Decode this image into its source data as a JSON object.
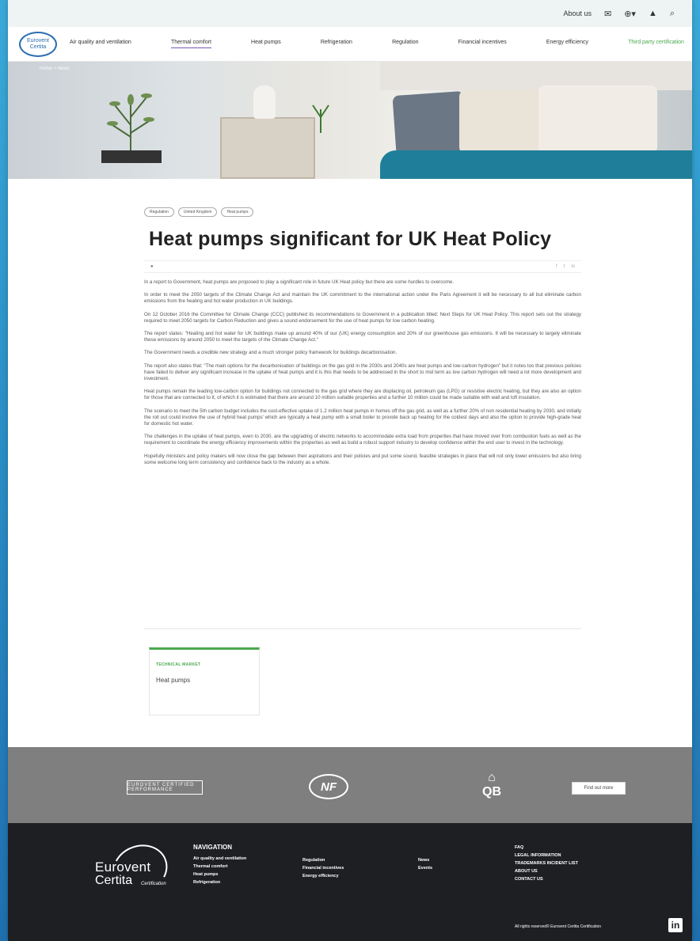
{
  "utility_bar": {
    "about_label": "About us",
    "mail_icon": "mail-icon",
    "globe_icon": "globe-icon",
    "user_icon": "user-icon",
    "search_icon": "search-icon"
  },
  "nav": {
    "logo_text_1": "Eurovent",
    "logo_text_2": "Certita",
    "items": [
      {
        "label": "Air quality and ventilation"
      },
      {
        "label": "Thermal comfort"
      },
      {
        "label": "Heat pumps"
      },
      {
        "label": "Refrigeration"
      },
      {
        "label": "Regulation"
      },
      {
        "label": "Financial incentives"
      },
      {
        "label": "Energy efficiency"
      },
      {
        "label": "Third party certification"
      }
    ]
  },
  "hero": {
    "breadcrumb": "Home > News"
  },
  "article": {
    "tags": [
      "Regulation",
      "United Kingdom",
      "Heat pumps"
    ],
    "title": "Heat pumps significant for UK Heat Policy",
    "date": "",
    "paragraphs": [
      "In a report to Government, heat pumps are proposed to play a significant role in future UK Heat policy but there are some hurdles to overcome.",
      "In order to meet the 2050 targets of the Climate Change Act and maintain the UK commitment to the international action under the Paris Agreement it will be necessary to all but eliminate carbon emissions from the heating and hot water production in UK buildings.",
      "On 12 October 2016 the Committee for Climate Change (CCC) published its recommendations to Government in a publication titled: Next Steps for UK Heat Policy. This report sets out the strategy required to meet 2050 targets for Carbon Reduction and gives a sound endorsement for the use of heat pumps for low carbon heating.",
      "The report states: \"Heating and hot water for UK buildings make up around 40% of our (UK) energy consumption and 20% of our greenhouse gas emissions. It will be necessary to largely eliminate these emissions by around 2050 to meet the targets of the Climate Change Act.\"",
      "The Government needs a credible new strategy and a much stronger policy framework for buildings decarbonisation.",
      "The report also states that: \"The main options for the decarbonisation of buildings on the gas grid in the 2030s and 2040s are heat pumps and low-carbon hydrogen\" but it notes too that previous policies have failed to deliver any significant increase in the uptake of heat pumps and it is this that needs to be addressed in the short to mid term as low carbon hydrogen will need a lot more development and investment.",
      "Heat pumps remain the leading low-carbon option for buildings not connected to the gas grid where they are displacing oil, petroleum gas (LPG) or resistive electric heating, but they are also an option for those that are connected to it, of which it is estimated that there are around 10 million suitable properties and a further 10 million could be made suitable with wall and loft insulation.",
      "The scenario to meet the 5th carbon budget includes the cost-effective uptake of 1.2 million heat pumps in homes off the gas grid, as well as a further 20% of non residential heating by 2030, and initially the roll out could involve the use of hybrid heat pumps' which are typically a heat pump with a small boiler to provide back up heating for the coldest days and also the option to provide high-grade heat for domestic hot water.",
      "The challenges in the uptake of heat pumps, even to 2030, are the upgrading of electric networks to accommodate extra load from properties that have moved over from combustion fuels as well as the requirement to coordinate the energy efficiency improvements within the properties as well as build a robust support industry to develop confidence within the end user to invest in the technology.",
      "Hopefully ministers and policy makers will now close the gap between their aspirations and their policies and put some sound, feasible strategies in place that will not only lower emissions but also bring some welcome long term consistency and confidence back to the industry as a whole."
    ]
  },
  "related": {
    "heading": "TECHNICAL MARKET",
    "value": "Heat pumps"
  },
  "logos": {
    "eurovent_label": "EUROVENT CERTIFIED PERFORMANCE",
    "nf_label": "NF",
    "qb_label": "QB",
    "find_out_more": "Find out more"
  },
  "footer": {
    "logo_line_1": "Eurovent",
    "logo_line_2": "Certita",
    "logo_tag": "Certification",
    "nav_heading": "NAVIGATION",
    "col1": [
      "Air quality and ventilation",
      "Thermal comfort",
      "Heat pumps",
      "Refrigeration"
    ],
    "col2": [
      "Regulation",
      "Financial incentives",
      "Energy efficiency"
    ],
    "col3": [
      "News",
      "Events"
    ],
    "col4": [
      "FAQ",
      "LEGAL INFORMATION",
      "TRADEMARKS INCIDENT LIST",
      "ABOUT US",
      "CONTACT US"
    ],
    "copyright": "All rights reserved© Eurovent Certita Certification",
    "linkedin_label": "in"
  }
}
